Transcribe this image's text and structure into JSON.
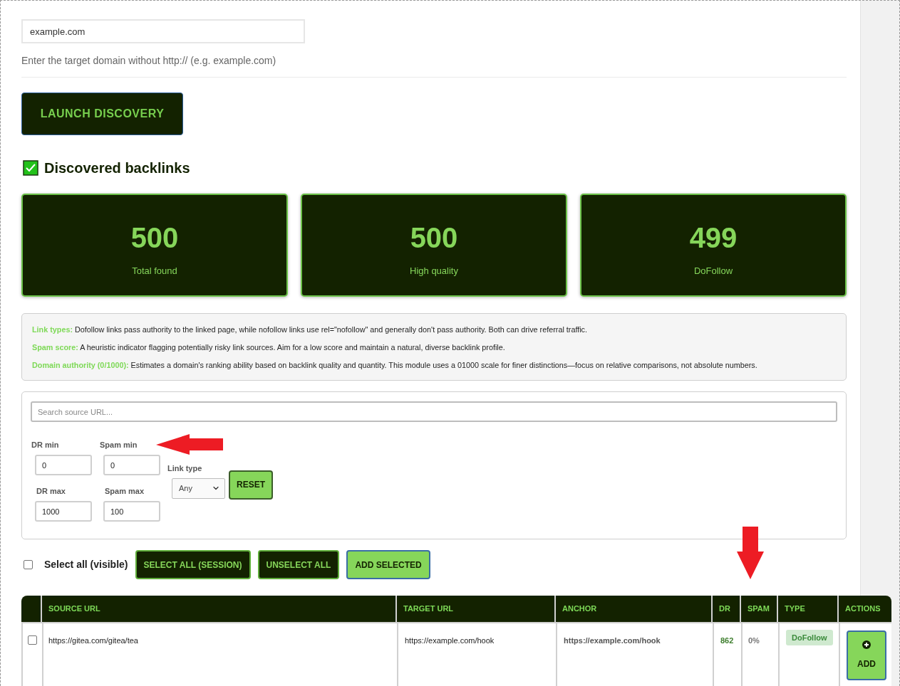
{
  "domain_field": {
    "value": "example.com"
  },
  "domain_hint": "Enter the target domain without http:// (e.g. example.com)",
  "launch_button": "LAUNCH DISCOVERY",
  "section_title": "Discovered backlinks",
  "stats": [
    {
      "value": "500",
      "label": "Total found"
    },
    {
      "value": "500",
      "label": "High quality"
    },
    {
      "value": "499",
      "label": "DoFollow"
    }
  ],
  "info": [
    {
      "term": "Link types:",
      "text": "Dofollow links pass authority to the linked page, while nofollow links use rel=\"nofollow\" and generally don't pass authority. Both can drive referral traffic."
    },
    {
      "term": "Spam score:",
      "text": "A heuristic indicator flagging potentially risky link sources. Aim for a low score and maintain a natural, diverse backlink profile."
    },
    {
      "term": "Domain authority (0/1000):",
      "text": "Estimates a domain's ranking ability based on backlink quality and quantity. This module uses a 01000 scale for finer distinctions—focus on relative comparisons, not absolute numbers."
    }
  ],
  "filters": {
    "search": {
      "placeholder": "Search source URL..."
    },
    "fields": [
      {
        "label": "DR min",
        "value": "0"
      },
      {
        "label": "Spam min",
        "value": "0"
      },
      {
        "label": "DR max",
        "value": "1000"
      },
      {
        "label": "Spam max",
        "value": "100"
      }
    ],
    "link_type": {
      "label": "Link type",
      "value": "Any"
    },
    "reset_button": "RESET"
  },
  "bulk": {
    "select_all": {
      "label": "Select all (visible)",
      "checked": false
    },
    "buttons": [
      {
        "label": "SELECT ALL (SESSION)",
        "kind": "dark"
      },
      {
        "label": "UNSELECT ALL",
        "kind": "dark"
      },
      {
        "label": "ADD SELECTED",
        "kind": "light"
      }
    ]
  },
  "table": {
    "columns": [
      "SOURCE URL",
      "TARGET URL",
      "ANCHOR",
      "DR",
      "SPAM",
      "TYPE",
      "ACTIONS"
    ],
    "rows": [
      {
        "checked": false,
        "source_url": "https://gitea.com/gitea/tea",
        "target_url": "https://example.com/hook",
        "anchor": "https://example.com/hook",
        "dr": "862",
        "spam": "0%",
        "type": "DoFollow",
        "action": "ADD"
      }
    ]
  }
}
